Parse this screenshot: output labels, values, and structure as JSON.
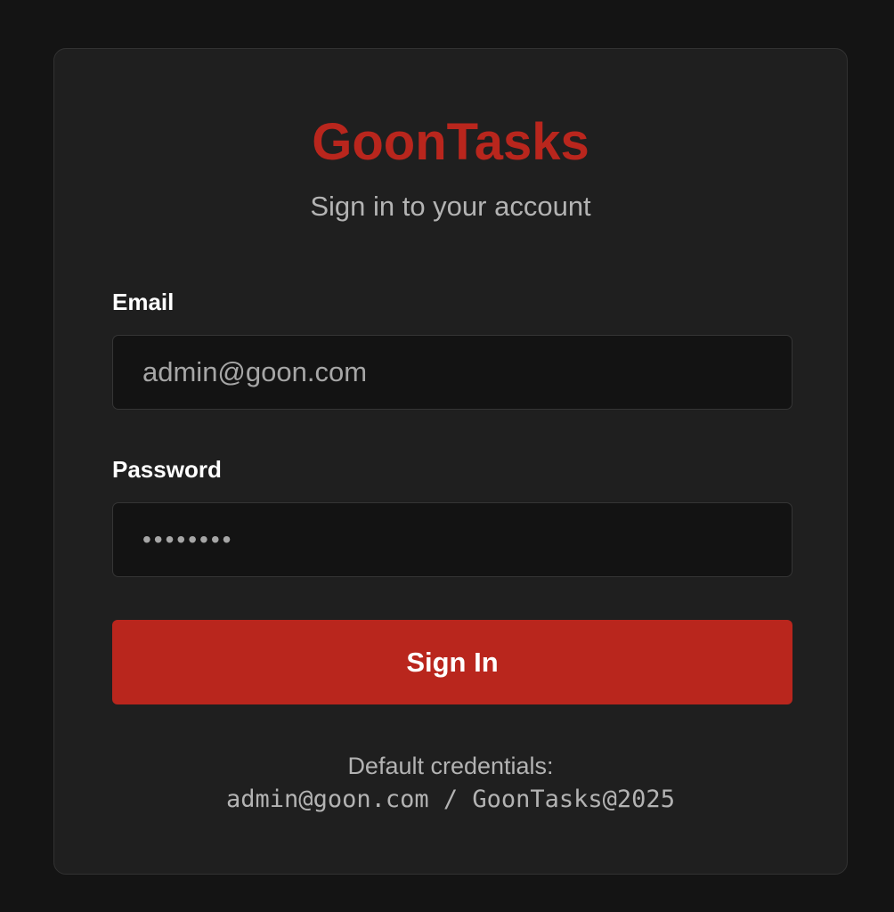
{
  "colors": {
    "background": "#141414",
    "card": "#1f1f1f",
    "accent": "#b9261d",
    "input_background": "#131313",
    "muted_text": "#b3b3b3"
  },
  "header": {
    "brand": "GoonTasks",
    "subtitle": "Sign in to your account"
  },
  "form": {
    "email_label": "Email",
    "email_value": "admin@goon.com",
    "password_label": "Password",
    "password_value": "••••••••",
    "submit_label": "Sign In"
  },
  "hint": {
    "title": "Default credentials:",
    "credentials": "admin@goon.com / GoonTasks@2025"
  }
}
